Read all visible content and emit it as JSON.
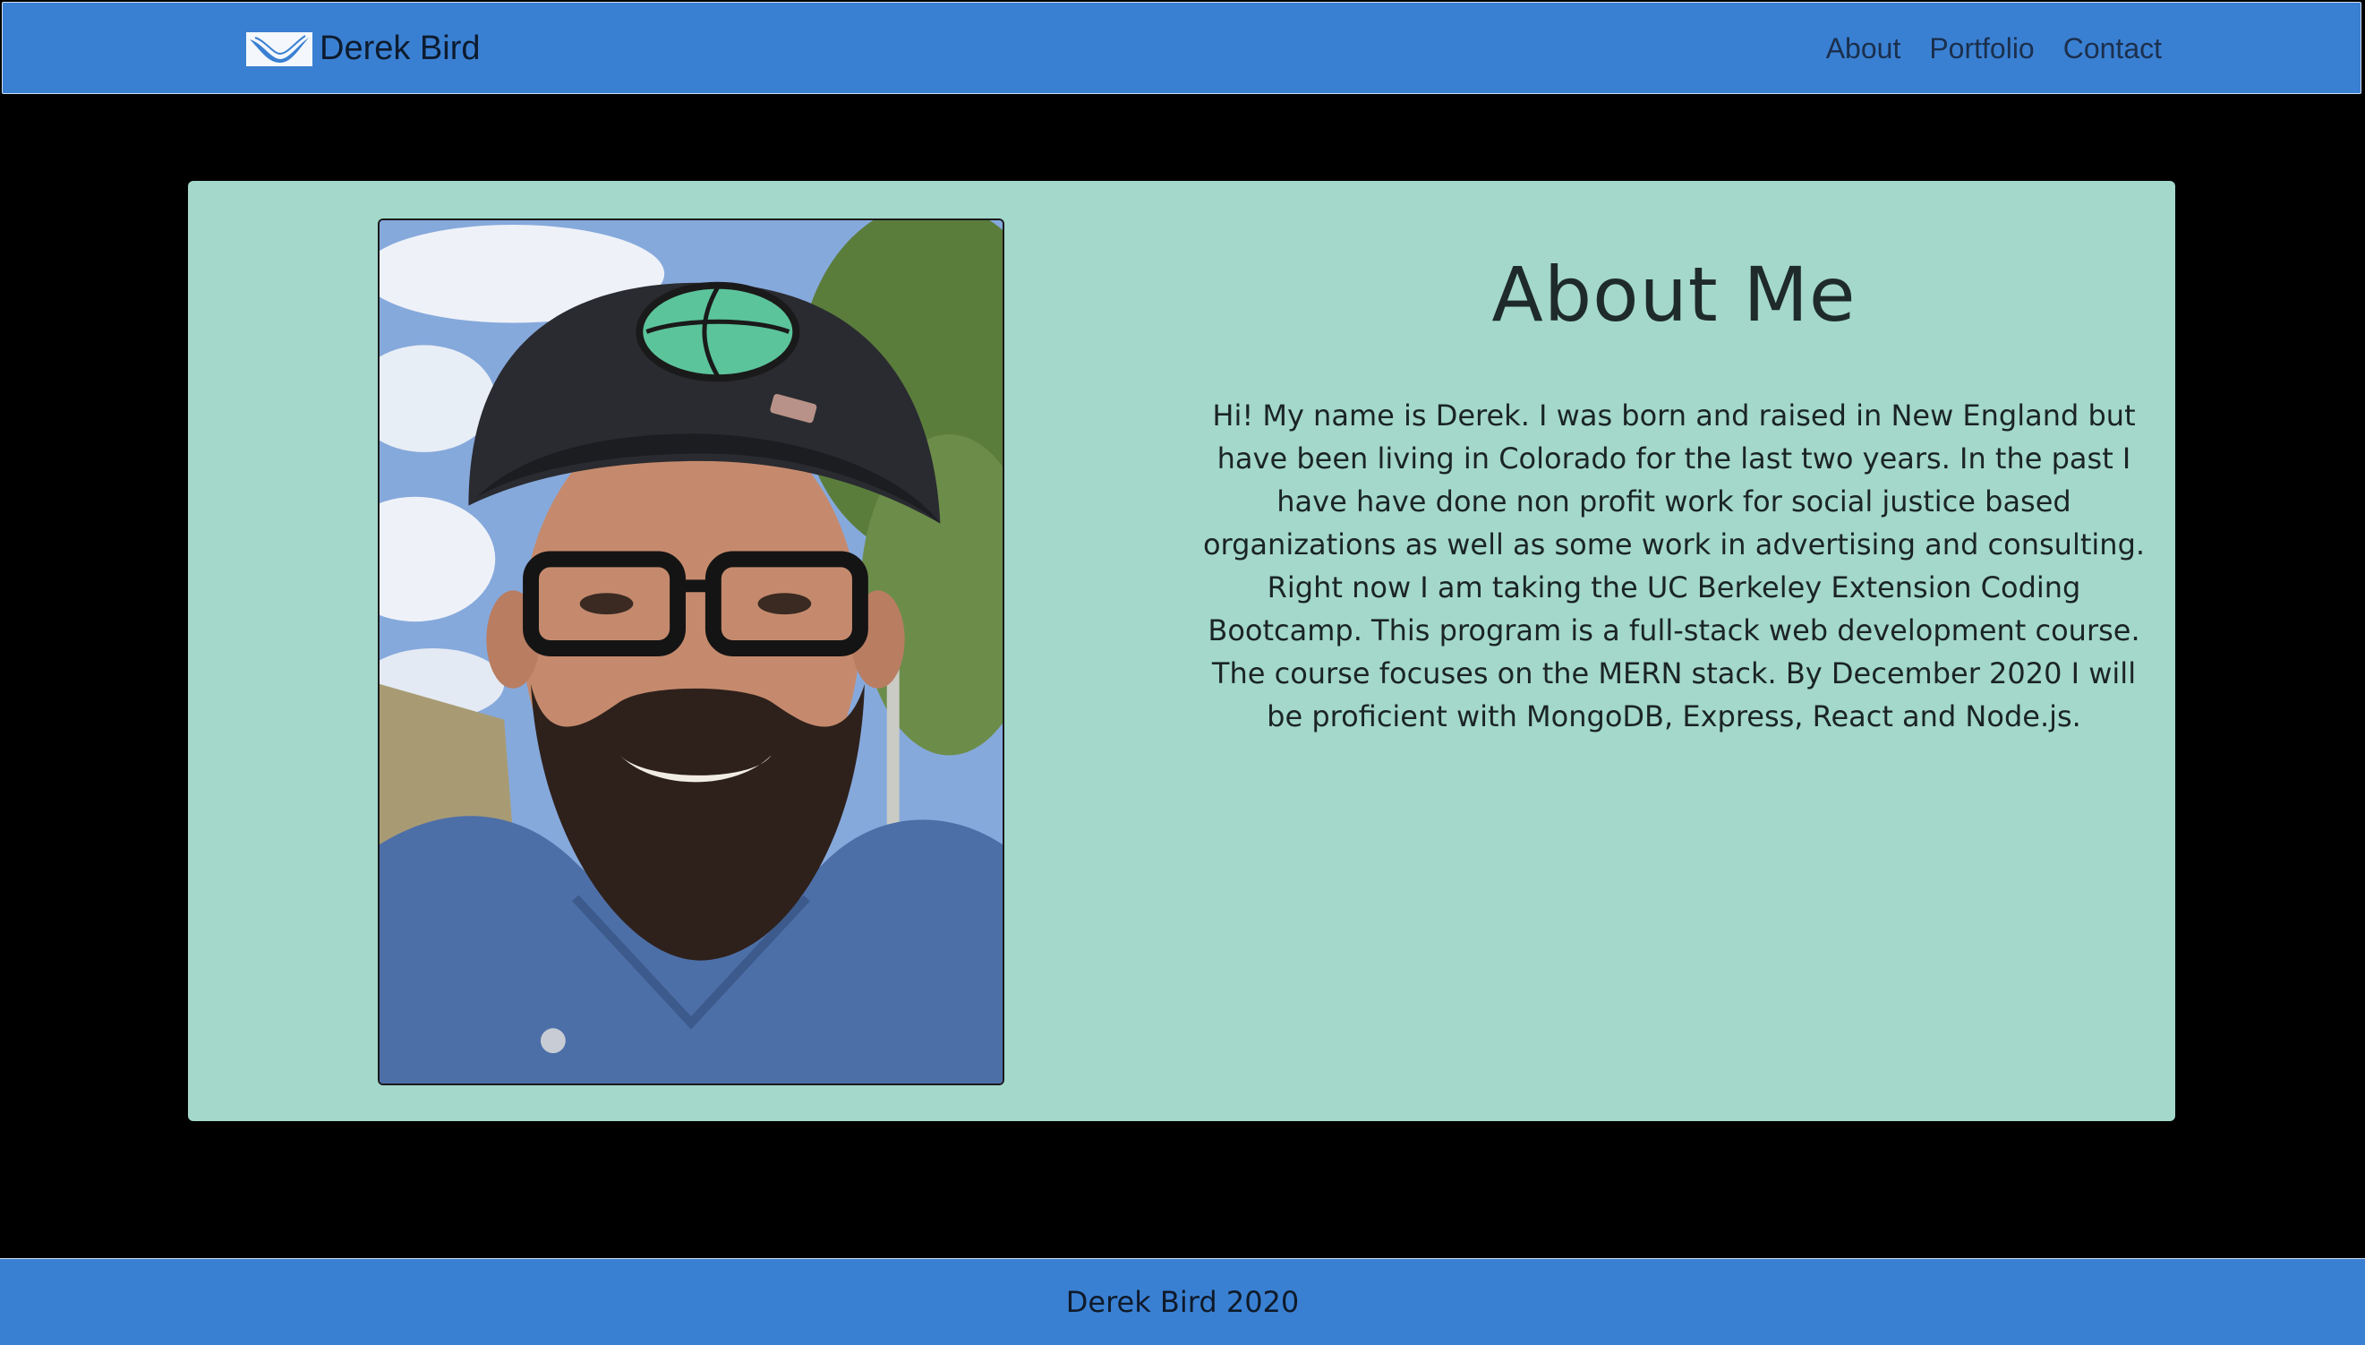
{
  "navbar": {
    "brand": "Derek Bird",
    "logo_icon": "bird-icon",
    "links": [
      {
        "label": "About"
      },
      {
        "label": "Portfolio"
      },
      {
        "label": "Contact"
      }
    ]
  },
  "main": {
    "photo_icon": "profile-photo",
    "title": "About Me",
    "bio": "Hi! My name is Derek. I was born and raised in New England but have been living in Colorado for the last two years. In the past I have have done non profit work for social justice based organizations as well as some work in advertising and consulting. Right now I am taking the UC Berkeley Extension Coding Bootcamp. This program is a full-stack web development course. The course focuses on the MERN stack. By December 2020 I will be proficient with MongoDB, Express, React and Node.js."
  },
  "footer": {
    "text": "Derek Bird 2020"
  },
  "colors": {
    "navbar_bg": "#3a80d2",
    "page_bg": "#000000",
    "card_bg": "#a3d8cb",
    "footer_bg": "#3a80d2"
  }
}
